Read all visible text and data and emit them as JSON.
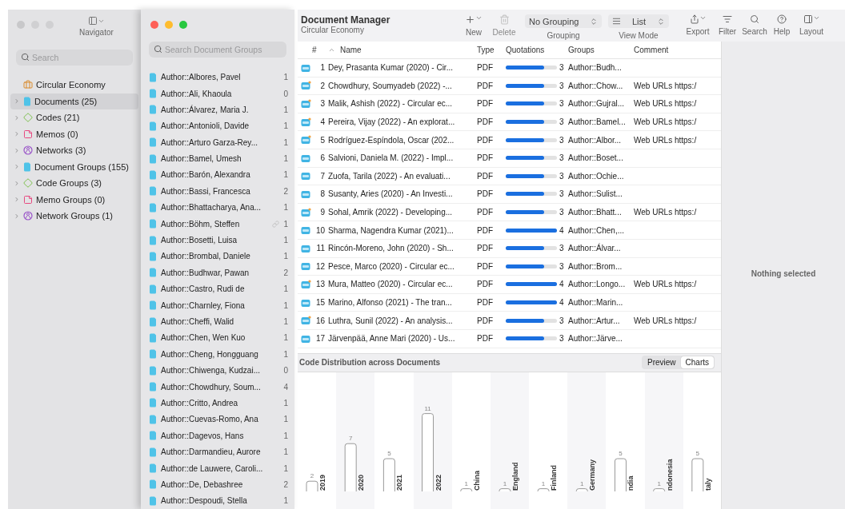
{
  "navigator": {
    "title": "Navigator",
    "search": {
      "placeholder": "Search"
    },
    "items": [
      {
        "kind": "project",
        "label": "Circular Economy",
        "selected": false,
        "expandable": false
      },
      {
        "kind": "documents",
        "label": "Documents (25)",
        "selected": true,
        "expandable": true
      },
      {
        "kind": "codes",
        "label": "Codes (21)",
        "selected": false,
        "expandable": true
      },
      {
        "kind": "memos",
        "label": "Memos (0)",
        "selected": false,
        "expandable": true
      },
      {
        "kind": "networks",
        "label": "Networks (3)",
        "selected": false,
        "expandable": true
      },
      {
        "kind": "documents",
        "label": "Document Groups (155)",
        "selected": false,
        "expandable": true
      },
      {
        "kind": "codes",
        "label": "Code Groups (3)",
        "selected": false,
        "expandable": true
      },
      {
        "kind": "memos",
        "label": "Memo Groups (0)",
        "selected": false,
        "expandable": true
      },
      {
        "kind": "networks",
        "label": "Network Groups (1)",
        "selected": false,
        "expandable": true
      }
    ]
  },
  "groups": {
    "search": {
      "placeholder": "Search Document Groups"
    },
    "items": [
      {
        "name": "Author::Albores, Pavel",
        "count": "1",
        "linked": false
      },
      {
        "name": "Author::Ali, Khaoula",
        "count": "0",
        "linked": false
      },
      {
        "name": "Author::Álvarez, Maria J.",
        "count": "1",
        "linked": false
      },
      {
        "name": "Author::Antonioli, Davide",
        "count": "1",
        "linked": false
      },
      {
        "name": "Author::Arturo Garza-Rey...",
        "count": "1",
        "linked": false
      },
      {
        "name": "Author::Bamel, Umesh",
        "count": "1",
        "linked": false
      },
      {
        "name": "Author::Barón, Alexandra",
        "count": "1",
        "linked": false
      },
      {
        "name": "Author::Bassi, Francesca",
        "count": "2",
        "linked": false
      },
      {
        "name": "Author::Bhattacharya, Ana...",
        "count": "1",
        "linked": false
      },
      {
        "name": "Author::Böhm, Steffen",
        "count": "1",
        "linked": true
      },
      {
        "name": "Author::Bosetti, Luisa",
        "count": "1",
        "linked": false
      },
      {
        "name": "Author::Brombal, Daniele",
        "count": "1",
        "linked": false
      },
      {
        "name": "Author::Budhwar, Pawan",
        "count": "2",
        "linked": false
      },
      {
        "name": "Author::Castro, Rudi de",
        "count": "1",
        "linked": false
      },
      {
        "name": "Author::Charnley, Fiona",
        "count": "1",
        "linked": false
      },
      {
        "name": "Author::Cheffi, Walid",
        "count": "1",
        "linked": false
      },
      {
        "name": "Author::Chen, Wen Kuo",
        "count": "1",
        "linked": false
      },
      {
        "name": "Author::Cheng, Hongguang",
        "count": "1",
        "linked": false
      },
      {
        "name": "Author::Chiwenga, Kudzai...",
        "count": "0",
        "linked": false
      },
      {
        "name": "Author::Chowdhury, Soum...",
        "count": "4",
        "linked": false
      },
      {
        "name": "Author::Critto, Andrea",
        "count": "1",
        "linked": false
      },
      {
        "name": "Author::Cuevas-Romo, Ana",
        "count": "1",
        "linked": false
      },
      {
        "name": "Author::Dagevos, Hans",
        "count": "1",
        "linked": false
      },
      {
        "name": "Author::Darmandieu, Aurore",
        "count": "1",
        "linked": false
      },
      {
        "name": "Author::de Lauwere, Caroli...",
        "count": "1",
        "linked": false
      },
      {
        "name": "Author::De, Debashree",
        "count": "2",
        "linked": false
      },
      {
        "name": "Author::Despoudi, Stella",
        "count": "1",
        "linked": false
      }
    ]
  },
  "toolbar": {
    "title": "Document Manager",
    "subtitle": "Circular Economy",
    "new": {
      "label": "New"
    },
    "delete": {
      "label": "Delete",
      "disabled": true
    },
    "grouping": {
      "value": "No Grouping",
      "label": "Grouping"
    },
    "view_mode": {
      "value": "List",
      "label": "View Mode"
    },
    "actions": [
      {
        "kind": "export",
        "label": "Export"
      },
      {
        "kind": "filter",
        "label": "Filter"
      },
      {
        "kind": "search",
        "label": "Search"
      },
      {
        "kind": "help",
        "label": "Help"
      },
      {
        "kind": "layout",
        "label": "Layout"
      }
    ]
  },
  "table": {
    "columns": [
      "#",
      "Name",
      "Type",
      "Quotations",
      "Groups",
      "Comment"
    ],
    "rows": [
      {
        "n": "1",
        "name": "Dey, Prasanta Kumar (2020) - Cir...",
        "type": "PDF",
        "quotations": "3",
        "level": 0.75,
        "groups": "Author::Budh...",
        "comment": ""
      },
      {
        "n": "2",
        "name": "Chowdhury, Soumyadeb (2022) -...",
        "type": "PDF",
        "quotations": "3",
        "level": 0.75,
        "groups": "Author::Chow...",
        "comment": "Web URLs https:/"
      },
      {
        "n": "3",
        "name": "Malik, Ashish (2022) - Circular ec...",
        "type": "PDF",
        "quotations": "3",
        "level": 0.75,
        "groups": "Author::Gujral...",
        "comment": "Web URLs https:/"
      },
      {
        "n": "4",
        "name": "Pereira, Vijay (2022) - An explorat...",
        "type": "PDF",
        "quotations": "3",
        "level": 0.75,
        "groups": "Author::Bamel...",
        "comment": "Web URLs https:/"
      },
      {
        "n": "5",
        "name": "Rodríguez-Espíndola, Oscar (202...",
        "type": "PDF",
        "quotations": "3",
        "level": 0.75,
        "groups": "Author::Albor...",
        "comment": "Web URLs https:/"
      },
      {
        "n": "6",
        "name": "Salvioni, Daniela M. (2022) - Impl...",
        "type": "PDF",
        "quotations": "3",
        "level": 0.75,
        "groups": "Author::Boset...",
        "comment": ""
      },
      {
        "n": "7",
        "name": "Zuofa, Tarila (2022) - An evaluati...",
        "type": "PDF",
        "quotations": "3",
        "level": 0.75,
        "groups": "Author::Ochie...",
        "comment": ""
      },
      {
        "n": "8",
        "name": "Susanty, Aries (2020) - An Investi...",
        "type": "PDF",
        "quotations": "3",
        "level": 0.75,
        "groups": "Author::Sulist...",
        "comment": ""
      },
      {
        "n": "9",
        "name": "Sohal, Amrik (2022) - Developing...",
        "type": "PDF",
        "quotations": "3",
        "level": 0.75,
        "groups": "Author::Bhatt...",
        "comment": "Web URLs https:/"
      },
      {
        "n": "10",
        "name": "Sharma, Nagendra Kumar (2021)...",
        "type": "PDF",
        "quotations": "4",
        "level": 1,
        "groups": "Author::Chen,...",
        "comment": ""
      },
      {
        "n": "11",
        "name": "Rincón-Moreno, John (2020) - Sh...",
        "type": "PDF",
        "quotations": "3",
        "level": 0.75,
        "groups": "Author::Álvar...",
        "comment": ""
      },
      {
        "n": "12",
        "name": "Pesce, Marco (2020) - Circular ec...",
        "type": "PDF",
        "quotations": "3",
        "level": 0.75,
        "groups": "Author::Brom...",
        "comment": ""
      },
      {
        "n": "13",
        "name": "Mura, Matteo (2020) - Circular ec...",
        "type": "PDF",
        "quotations": "4",
        "level": 1,
        "groups": "Author::Longo...",
        "comment": "Web URLs https:/"
      },
      {
        "n": "15",
        "name": "Marino, Alfonso (2021) - The tran...",
        "type": "PDF",
        "quotations": "4",
        "level": 1,
        "groups": "Author::Marin...",
        "comment": ""
      },
      {
        "n": "16",
        "name": "Luthra, Sunil (2022) - An analysis...",
        "type": "PDF",
        "quotations": "3",
        "level": 0.75,
        "groups": "Author::Artur...",
        "comment": "Web URLs https:/"
      },
      {
        "n": "17",
        "name": "Järvenpää, Anne Mari (2020) - Us...",
        "type": "PDF",
        "quotations": "3",
        "level": 0.75,
        "groups": "Author::Järve...",
        "comment": ""
      }
    ]
  },
  "chart_panel": {
    "title": "Code Distribution across Documents",
    "segments": [
      {
        "label": "Preview",
        "selected": false
      },
      {
        "label": "Charts",
        "selected": true
      }
    ],
    "chart_data": {
      "type": "bar",
      "categories": [
        "2019",
        "2020",
        "2021",
        "2022",
        "China",
        "England",
        "Finland",
        "Germany",
        "ndia",
        "ndonesia",
        "taly"
      ],
      "values": [
        2,
        7,
        5,
        11,
        1,
        1,
        1,
        1,
        5,
        1,
        5
      ],
      "data_labels": true
    }
  },
  "inspector": {
    "message": "Nothing selected"
  }
}
